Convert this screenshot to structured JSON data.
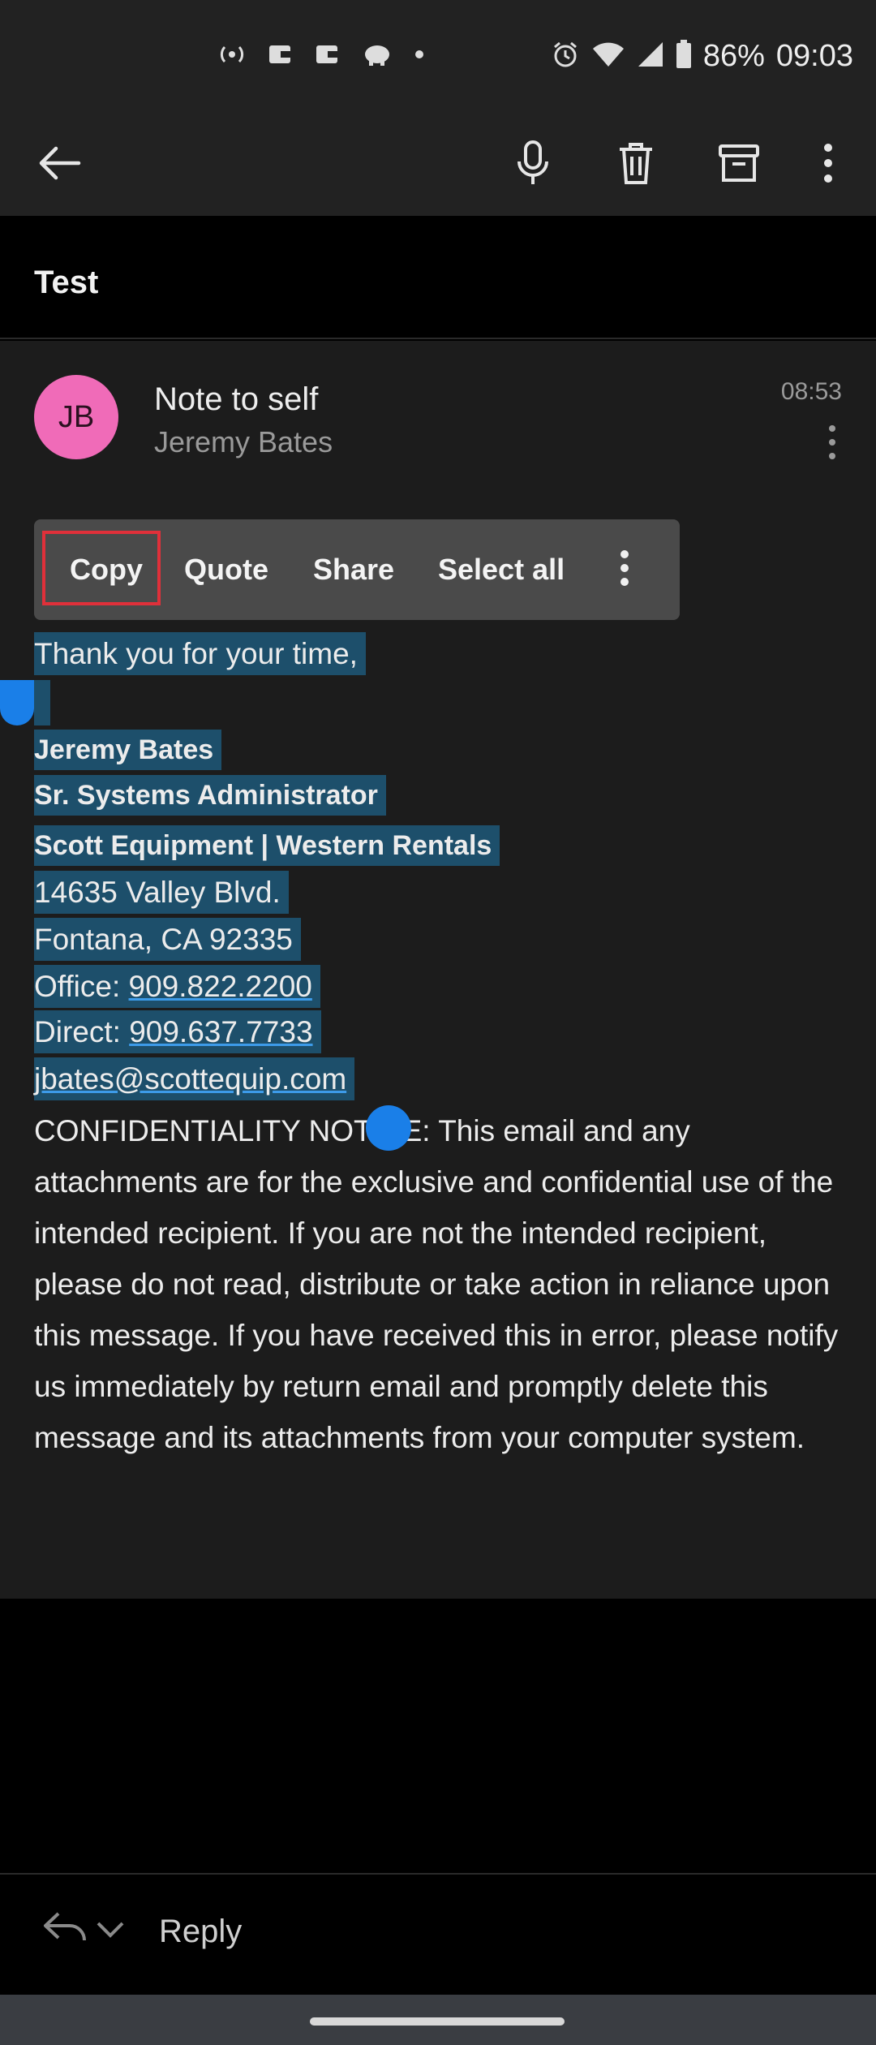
{
  "status_bar": {
    "battery": "86%",
    "time": "09:03"
  },
  "message": {
    "subject": "Test",
    "avatar_initials": "JB",
    "from_title": "Note to self",
    "sender_name": "Jeremy Bates",
    "time": "08:53"
  },
  "selection_menu": {
    "items": [
      "Copy",
      "Quote",
      "Share",
      "Select all"
    ]
  },
  "body": {
    "lines": [
      "Thank you for your time,",
      "Jeremy Bates",
      "Sr. Systems Administrator",
      "Scott Equipment | Western Rentals",
      "14635 Valley Blvd.",
      "Fontana, CA 92335"
    ],
    "office_label": "Office: ",
    "office_phone": "909.822.2200",
    "direct_label": "Direct: ",
    "direct_phone": "909.637.7733",
    "email": "jbates@scottequip.com",
    "confidentiality": "CONFIDENTIALITY NOTICE: This email and any attachments are for the exclusive and confidential use of the intended recipient. If you are not the intended recipient, please do not read, distribute or take action in reliance upon this message. If you have received this in error, please notify us immediately by return email and promptly delete this message and its attachments from your computer system."
  },
  "reply": {
    "label": "Reply"
  },
  "colors": {
    "avatar": "#f06bb8",
    "selection_highlight": "#1d4f6b",
    "selection_handle": "#1a7fe8",
    "copy_outline": "#e0303a"
  },
  "icons": [
    "back-arrow-icon",
    "microphone-icon",
    "trash-icon",
    "archive-icon",
    "more-vert-icon",
    "reply-icon",
    "chevron-down-icon"
  ]
}
